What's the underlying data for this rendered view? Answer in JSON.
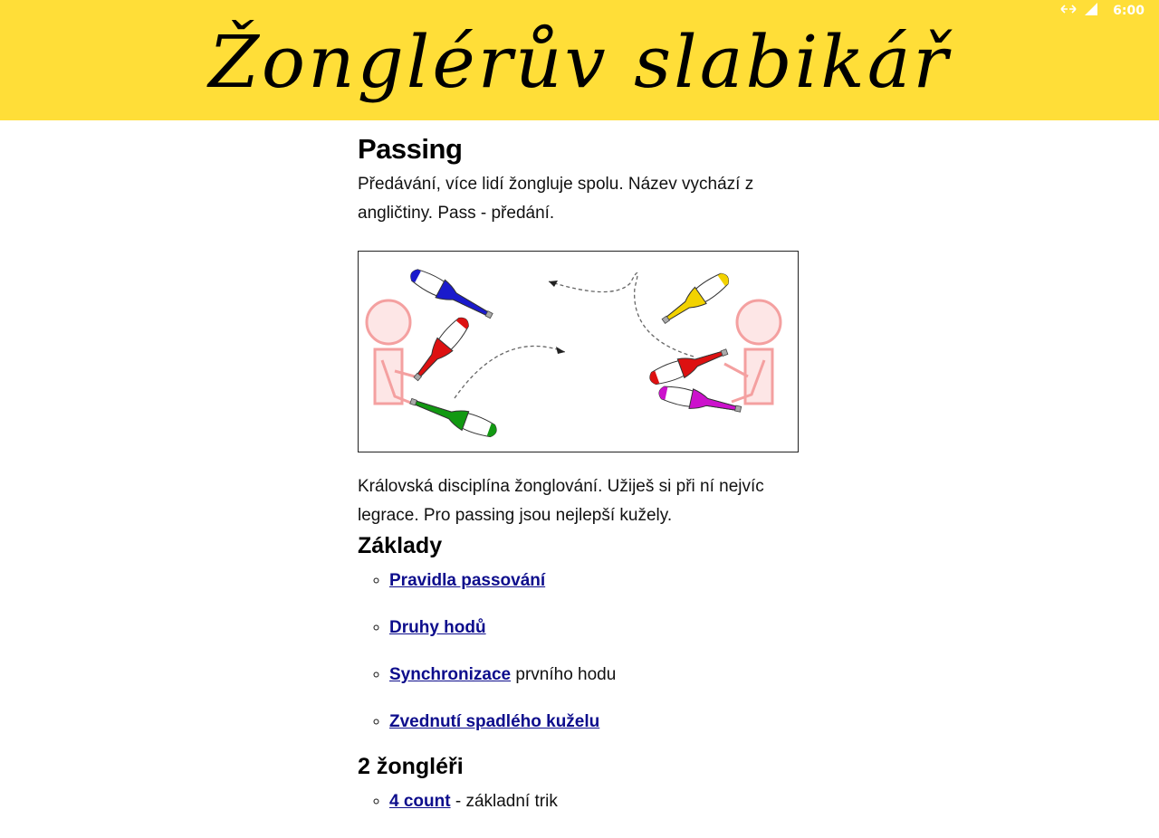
{
  "status_bar": {
    "time": "6:00",
    "icons": [
      "data-arrows-icon",
      "signal-lte-icon"
    ]
  },
  "header": {
    "title": "Žonglérův slabikář",
    "background_color": "#ffde38"
  },
  "page": {
    "heading": "Passing",
    "intro": "Předávání, více lidí žongluje spolu. Název vychází z angličtiny. Pass - předání.",
    "figure_icon": "two-jugglers-passing-clubs-illustration",
    "description": "Královská disciplína žonglování. Užiješ si při ní nejvíc legrace. Pro passing jsou nejlepší kužely.",
    "sections": [
      {
        "heading": "Základy",
        "items": [
          {
            "link": "Pravidla passování",
            "suffix": ""
          },
          {
            "link": "Druhy hodů",
            "suffix": ""
          },
          {
            "link": "Synchronizace",
            "suffix": " prvního hodu"
          },
          {
            "link": "Zvednutí spadlého kuželu",
            "suffix": ""
          }
        ]
      },
      {
        "heading": "2 žongléři",
        "items": [
          {
            "link": "4 count",
            "suffix": " - základní trik"
          }
        ]
      }
    ]
  },
  "colors": {
    "link": "#0d0d8c",
    "figure_person": "#f4a0a0"
  }
}
